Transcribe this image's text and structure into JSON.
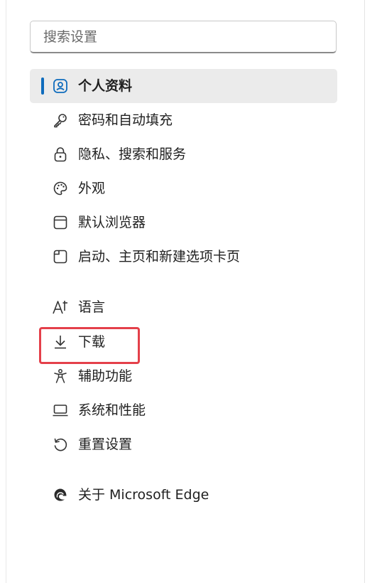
{
  "search": {
    "placeholder": "搜索设置"
  },
  "nav": {
    "items": [
      {
        "label": "个人资料",
        "icon": "profile-icon",
        "selected": true
      },
      {
        "label": "密码和自动填充",
        "icon": "key-icon"
      },
      {
        "label": "隐私、搜索和服务",
        "icon": "lock-icon"
      },
      {
        "label": "外观",
        "icon": "palette-icon"
      },
      {
        "label": "默认浏览器",
        "icon": "browser-window-icon"
      },
      {
        "label": "启动、主页和新建选项卡页",
        "icon": "tabs-icon"
      },
      {
        "label": "语言",
        "icon": "language-icon"
      },
      {
        "label": "下载",
        "icon": "download-icon"
      },
      {
        "label": "辅助功能",
        "icon": "accessibility-icon"
      },
      {
        "label": "系统和性能",
        "icon": "laptop-icon"
      },
      {
        "label": "重置设置",
        "icon": "reset-icon"
      },
      {
        "label": "关于 Microsoft Edge",
        "icon": "edge-logo-icon"
      }
    ]
  },
  "colors": {
    "accent": "#0f6cbd",
    "selected_bg": "#ebebeb",
    "highlight": "#e4404a"
  }
}
